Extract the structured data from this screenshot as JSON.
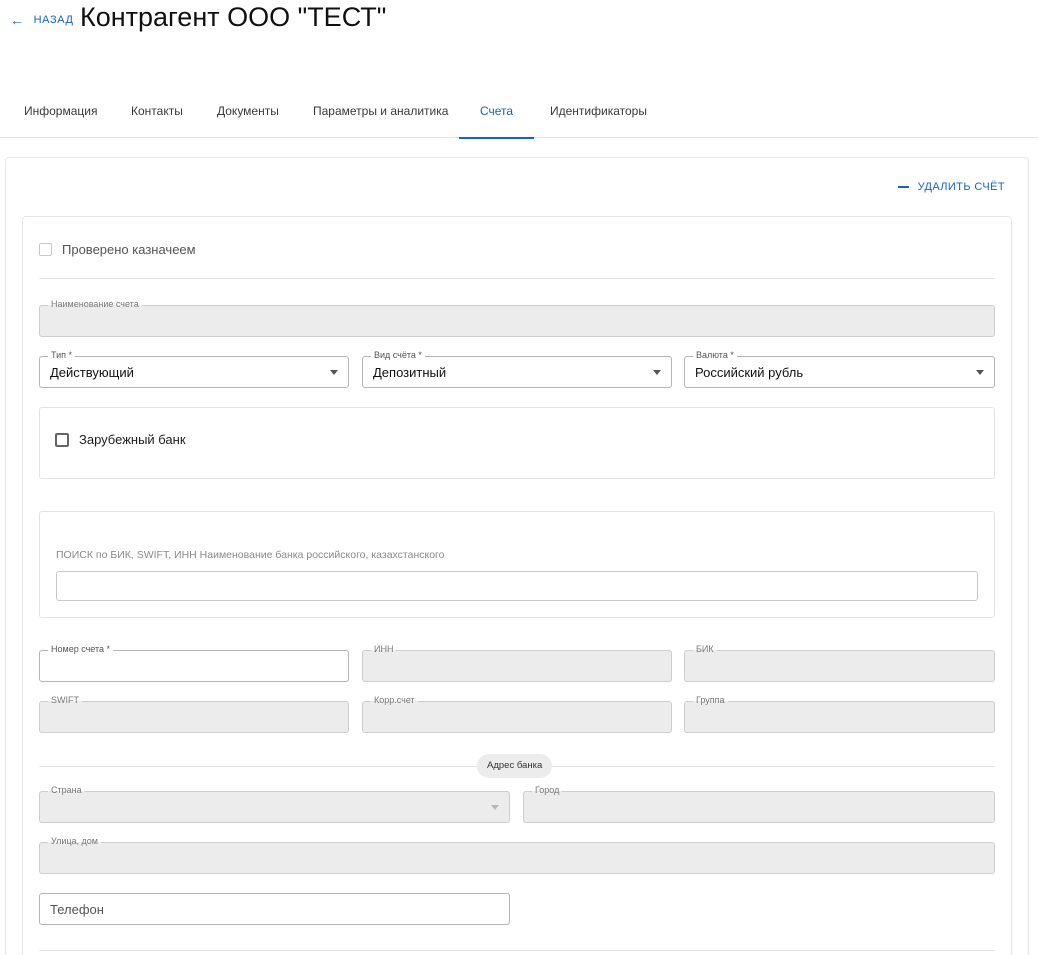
{
  "header": {
    "back_label": "НАЗАД",
    "title": "Контрагент ООО \"ТЕСТ\""
  },
  "tabs": [
    {
      "label": "Информация",
      "active": false
    },
    {
      "label": "Контакты",
      "active": false
    },
    {
      "label": "Документы",
      "active": false
    },
    {
      "label": "Параметры и аналитика",
      "active": false
    },
    {
      "label": "Счета",
      "active": true
    },
    {
      "label": "Идентификаторы",
      "active": false
    }
  ],
  "account": {
    "delete_label": "УДАЛИТЬ СЧЁТ",
    "verified_label": "Проверено казначеем",
    "name_label": "Наименование счета",
    "type_label": "Тип *",
    "type_value": "Действующий",
    "kind_label": "Вид счёта *",
    "kind_value": "Депозитный",
    "currency_label": "Валюта *",
    "currency_value": "Российский рубль",
    "foreign_bank_label": "Зарубежный банк",
    "search_hint": "ПОИСК по БИК, SWIFT, ИНН Наименование банка российского, казахстанского",
    "number_label": "Номер счета *",
    "inn_label": "ИНН",
    "bik_label": "БИК",
    "swift_label": "SWIFT",
    "corr_label": "Корр.счет",
    "group_label": "Группа",
    "bank_address_label": "Адрес банка",
    "country_label": "Страна",
    "city_label": "Город",
    "street_label": "Улица, дом",
    "phone_placeholder": "Телефон"
  },
  "colors": {
    "accent": "#1565c0",
    "disabled_bg": "#ececec",
    "border": "#e3e3e3"
  }
}
